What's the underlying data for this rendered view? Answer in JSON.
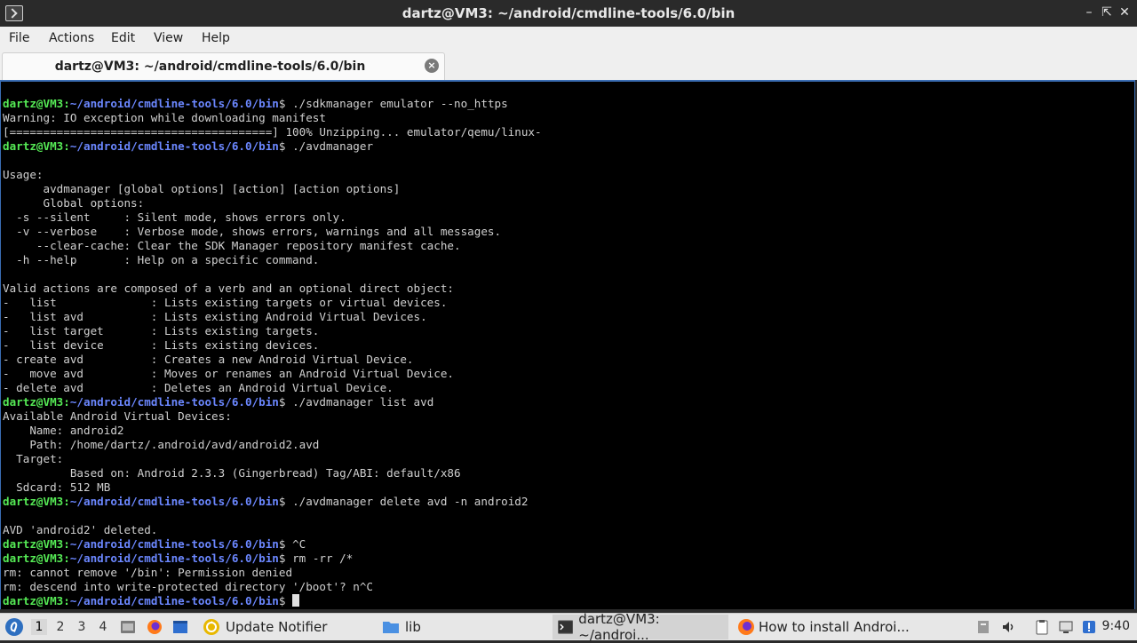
{
  "window": {
    "title": "dartz@VM3: ~/android/cmdline-tools/6.0/bin"
  },
  "menu": [
    "File",
    "Actions",
    "Edit",
    "View",
    "Help"
  ],
  "tab": {
    "label": "dartz@VM3: ~/android/cmdline-tools/6.0/bin",
    "close_symbol": "×"
  },
  "terminal": {
    "prompt_user": "dartz@VM3",
    "prompt_sep": ":",
    "prompt_path": "~/android/cmdline-tools/6.0/bin",
    "prompt_suffix": "$",
    "lines": [
      {
        "type": "prompt",
        "cmd": " ./sdkmanager emulator --no_https"
      },
      {
        "type": "text",
        "text": "Warning: IO exception while downloading manifest"
      },
      {
        "type": "text",
        "text": "[=======================================] 100% Unzipping... emulator/qemu/linux-"
      },
      {
        "type": "prompt",
        "cmd": " ./avdmanager"
      },
      {
        "type": "text",
        "text": ""
      },
      {
        "type": "text",
        "text": "Usage:"
      },
      {
        "type": "text",
        "text": "      avdmanager [global options] [action] [action options]"
      },
      {
        "type": "text",
        "text": "      Global options:"
      },
      {
        "type": "text",
        "text": "  -s --silent     : Silent mode, shows errors only."
      },
      {
        "type": "text",
        "text": "  -v --verbose    : Verbose mode, shows errors, warnings and all messages."
      },
      {
        "type": "text",
        "text": "     --clear-cache: Clear the SDK Manager repository manifest cache."
      },
      {
        "type": "text",
        "text": "  -h --help       : Help on a specific command."
      },
      {
        "type": "text",
        "text": ""
      },
      {
        "type": "text",
        "text": "Valid actions are composed of a verb and an optional direct object:"
      },
      {
        "type": "text",
        "text": "-   list              : Lists existing targets or virtual devices."
      },
      {
        "type": "text",
        "text": "-   list avd          : Lists existing Android Virtual Devices."
      },
      {
        "type": "text",
        "text": "-   list target       : Lists existing targets."
      },
      {
        "type": "text",
        "text": "-   list device       : Lists existing devices."
      },
      {
        "type": "text",
        "text": "- create avd          : Creates a new Android Virtual Device."
      },
      {
        "type": "text",
        "text": "-   move avd          : Moves or renames an Android Virtual Device."
      },
      {
        "type": "text",
        "text": "- delete avd          : Deletes an Android Virtual Device."
      },
      {
        "type": "prompt",
        "cmd": " ./avdmanager list avd"
      },
      {
        "type": "text",
        "text": "Available Android Virtual Devices:"
      },
      {
        "type": "text",
        "text": "    Name: android2"
      },
      {
        "type": "text",
        "text": "    Path: /home/dartz/.android/avd/android2.avd"
      },
      {
        "type": "text",
        "text": "  Target:"
      },
      {
        "type": "text",
        "text": "          Based on: Android 2.3.3 (Gingerbread) Tag/ABI: default/x86"
      },
      {
        "type": "text",
        "text": "  Sdcard: 512 MB"
      },
      {
        "type": "prompt",
        "cmd": " ./avdmanager delete avd -n android2"
      },
      {
        "type": "text",
        "text": ""
      },
      {
        "type": "text",
        "text": "AVD 'android2' deleted."
      },
      {
        "type": "prompt",
        "cmd": " ^C"
      },
      {
        "type": "prompt",
        "cmd": " rm -rr /*"
      },
      {
        "type": "text",
        "text": "rm: cannot remove '/bin': Permission denied"
      },
      {
        "type": "text",
        "text": "rm: descend into write-protected directory '/boot'? n^C"
      },
      {
        "type": "prompt",
        "cmd": " ",
        "cursor": true
      }
    ]
  },
  "taskbar": {
    "workspaces": [
      "1",
      "2",
      "3",
      "4"
    ],
    "update_notifier": "Update Notifier",
    "folder": "lib",
    "terminal_task": "dartz@VM3: ~/androi...",
    "browser_task": "How to install Androi...",
    "clock": "9:40",
    "colors": {
      "accent": "#3a6db3",
      "prompt_user": "#55e955",
      "prompt_path": "#6b87ff"
    }
  }
}
